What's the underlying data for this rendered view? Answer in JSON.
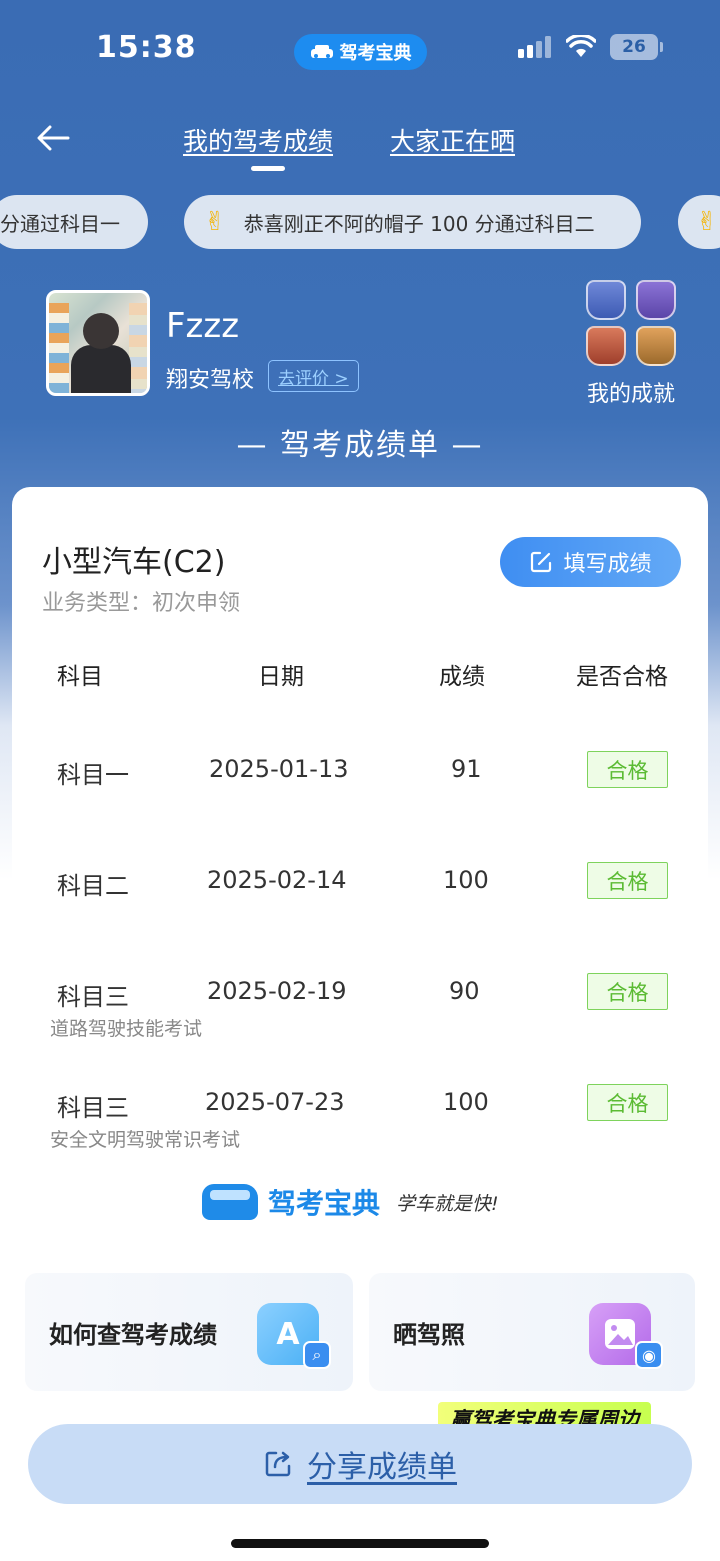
{
  "status_bar": {
    "time": "15:38",
    "app_pill": "驾考宝典",
    "battery": "26"
  },
  "nav": {
    "tabs": [
      {
        "label": "我的驾考成绩",
        "active": true
      },
      {
        "label": "大家正在晒",
        "active": false
      }
    ]
  },
  "ticker": {
    "items": [
      "分通过科目一",
      "恭喜刚正不阿的帽子 100 分通过科目二",
      ""
    ]
  },
  "profile": {
    "username": "Fzzz",
    "school": "翔安驾校",
    "rate_label": "去评价 >",
    "achievements_label": "我的成就"
  },
  "report_title": "— 驾考成绩单 —",
  "card": {
    "car_type": "小型汽车(C2)",
    "business_type": "业务类型：初次申领",
    "fill_button": "填写成绩",
    "columns": [
      "科目",
      "日期",
      "成绩",
      "是否合格"
    ],
    "rows": [
      {
        "subject": "科目一",
        "date": "2025-01-13",
        "score": "91",
        "result": "合格",
        "note": ""
      },
      {
        "subject": "科目二",
        "date": "2025-02-14",
        "score": "100",
        "result": "合格",
        "note": ""
      },
      {
        "subject": "科目三",
        "date": "2025-02-19",
        "score": "90",
        "result": "合格",
        "note": "道路驾驶技能考试"
      },
      {
        "subject": "科目三",
        "date": "2025-07-23",
        "score": "100",
        "result": "合格",
        "note": "安全文明驾驶常识考试"
      }
    ],
    "brand_name": "驾考宝典",
    "brand_slogan": "学车就是快!"
  },
  "bottom_cards": [
    {
      "label": "如何查驾考成绩",
      "icon": "A"
    },
    {
      "label": "晒驾照",
      "icon": ""
    }
  ],
  "promo": "赢驾考宝典专属周边",
  "share_button": "分享成绩单",
  "colors": {
    "header_blue": "#3a6cb4",
    "accent_blue": "#3f8ef2",
    "pass_green": "#5bbb33"
  }
}
